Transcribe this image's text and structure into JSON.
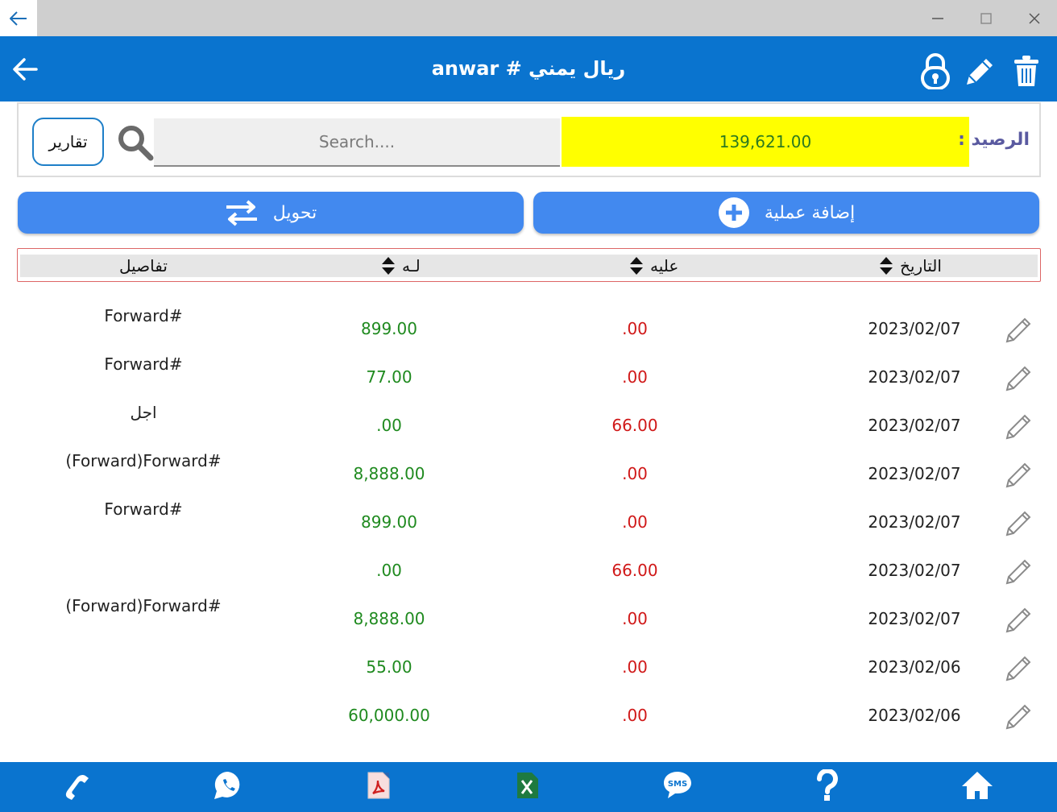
{
  "window": {
    "back_icon": "arrow-left-icon",
    "minimize_icon": "minimize-icon",
    "maximize_icon": "maximize-icon",
    "close_icon": "close-icon"
  },
  "header": {
    "title": "ريال يمني # anwar",
    "back_icon": "arrow-left-icon",
    "icons": [
      "lock-icon",
      "pencil-icon",
      "trash-icon"
    ]
  },
  "balance": {
    "label": "الرصيد :",
    "value": "139,621.00",
    "search_placeholder": "Search....",
    "reports_label": "تقارير"
  },
  "actions": {
    "transfer_label": "تحويل",
    "add_label": "إضافة عملية"
  },
  "table": {
    "headers": {
      "date": "التاريخ",
      "debit": "عليه",
      "credit": "لـه",
      "details": "تفاصيل"
    },
    "rows": [
      {
        "date": "2023/02/07",
        "debit": ".00",
        "credit": "899.00",
        "details": "Forward#"
      },
      {
        "date": "2023/02/07",
        "debit": ".00",
        "credit": "77.00",
        "details": "Forward#"
      },
      {
        "date": "2023/02/07",
        "debit": "66.00",
        "credit": ".00",
        "details": "اجل"
      },
      {
        "date": "2023/02/07",
        "debit": ".00",
        "credit": "8,888.00",
        "details": "(Forward)Forward#"
      },
      {
        "date": "2023/02/07",
        "debit": ".00",
        "credit": "899.00",
        "details": "Forward#"
      },
      {
        "date": "2023/02/07",
        "debit": "66.00",
        "credit": ".00",
        "details": ""
      },
      {
        "date": "2023/02/07",
        "debit": ".00",
        "credit": "8,888.00",
        "details": "(Forward)Forward#"
      },
      {
        "date": "2023/02/06",
        "debit": ".00",
        "credit": "55.00",
        "details": ""
      },
      {
        "date": "2023/02/06",
        "debit": ".00",
        "credit": "60,000.00",
        "details": ""
      }
    ]
  },
  "bottom_nav": [
    "phone-icon",
    "whatsapp-icon",
    "pdf-icon",
    "excel-icon",
    "sms-icon",
    "help-icon",
    "home-icon"
  ],
  "colors": {
    "primary": "#0a74cf",
    "button": "#4289ef",
    "balance_bg": "#ffff00",
    "credit": "#1f8a1f",
    "debit": "#d01818"
  }
}
